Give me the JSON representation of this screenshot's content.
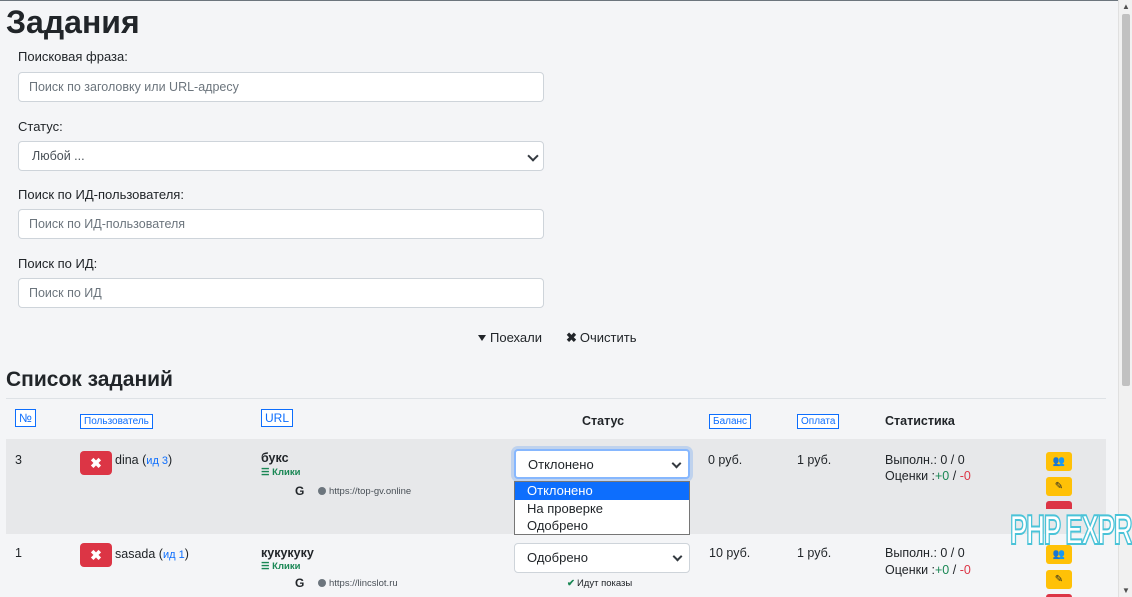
{
  "page_title": "Задания",
  "filters": {
    "search_label": "Поисковая фраза:",
    "search_placeholder": "Поиск по заголовку или URL-адресу",
    "status_label": "Статус:",
    "status_value": "Любой ...",
    "user_id_label": "Поиск по ИД-пользователя:",
    "user_id_placeholder": "Поиск по ИД-пользователя",
    "id_label": "Поиск по ИД:",
    "id_placeholder": "Поиск по ИД",
    "submit_label": "Поехали",
    "clear_label": "Очистить"
  },
  "list": {
    "title": "Список заданий",
    "headers": {
      "num": "№",
      "user": "Пользователь",
      "url": "URL",
      "status": "Статус",
      "balance": "Баланс",
      "payment": "Оплата",
      "stats": "Статистика"
    },
    "rows": [
      {
        "num": "3",
        "user": "dina",
        "uid_prefix": "(",
        "uid_link": "ид 3",
        "uid_suffix": ")",
        "title": "букс",
        "type": "Клики",
        "g": "G",
        "url": "https://top-gv.online",
        "status": "Отклонено",
        "balance": "0 руб.",
        "payment": "1 руб.",
        "done_label": "Выполн.: 0 / 0",
        "ratings_label": "Оценки :",
        "ratings_plus": "+0",
        "ratings_sep": " / ",
        "ratings_minus": "-0"
      },
      {
        "num": "1",
        "user": "sasada",
        "uid_prefix": "(",
        "uid_link": "ид 1",
        "uid_suffix": ")",
        "title": "кукукуку",
        "type": "Клики",
        "g": "G",
        "url": "https://lincslot.ru",
        "status": "Одобрено",
        "status_note": "Идут показы",
        "balance": "10 руб.",
        "payment": "1 руб.",
        "done_label": "Выполн.: 0 / 0",
        "ratings_label": "Оценки :",
        "ratings_plus": "+0",
        "ratings_sep": " / ",
        "ratings_minus": "-0"
      }
    ],
    "status_options": [
      "Отклонено",
      "На проверке",
      "Одобрено"
    ]
  },
  "watermark": "PHP EXPRESS",
  "colors": {
    "accent": "#0d6efd",
    "danger": "#dc3545",
    "success": "#198754",
    "warning": "#ffc107"
  }
}
